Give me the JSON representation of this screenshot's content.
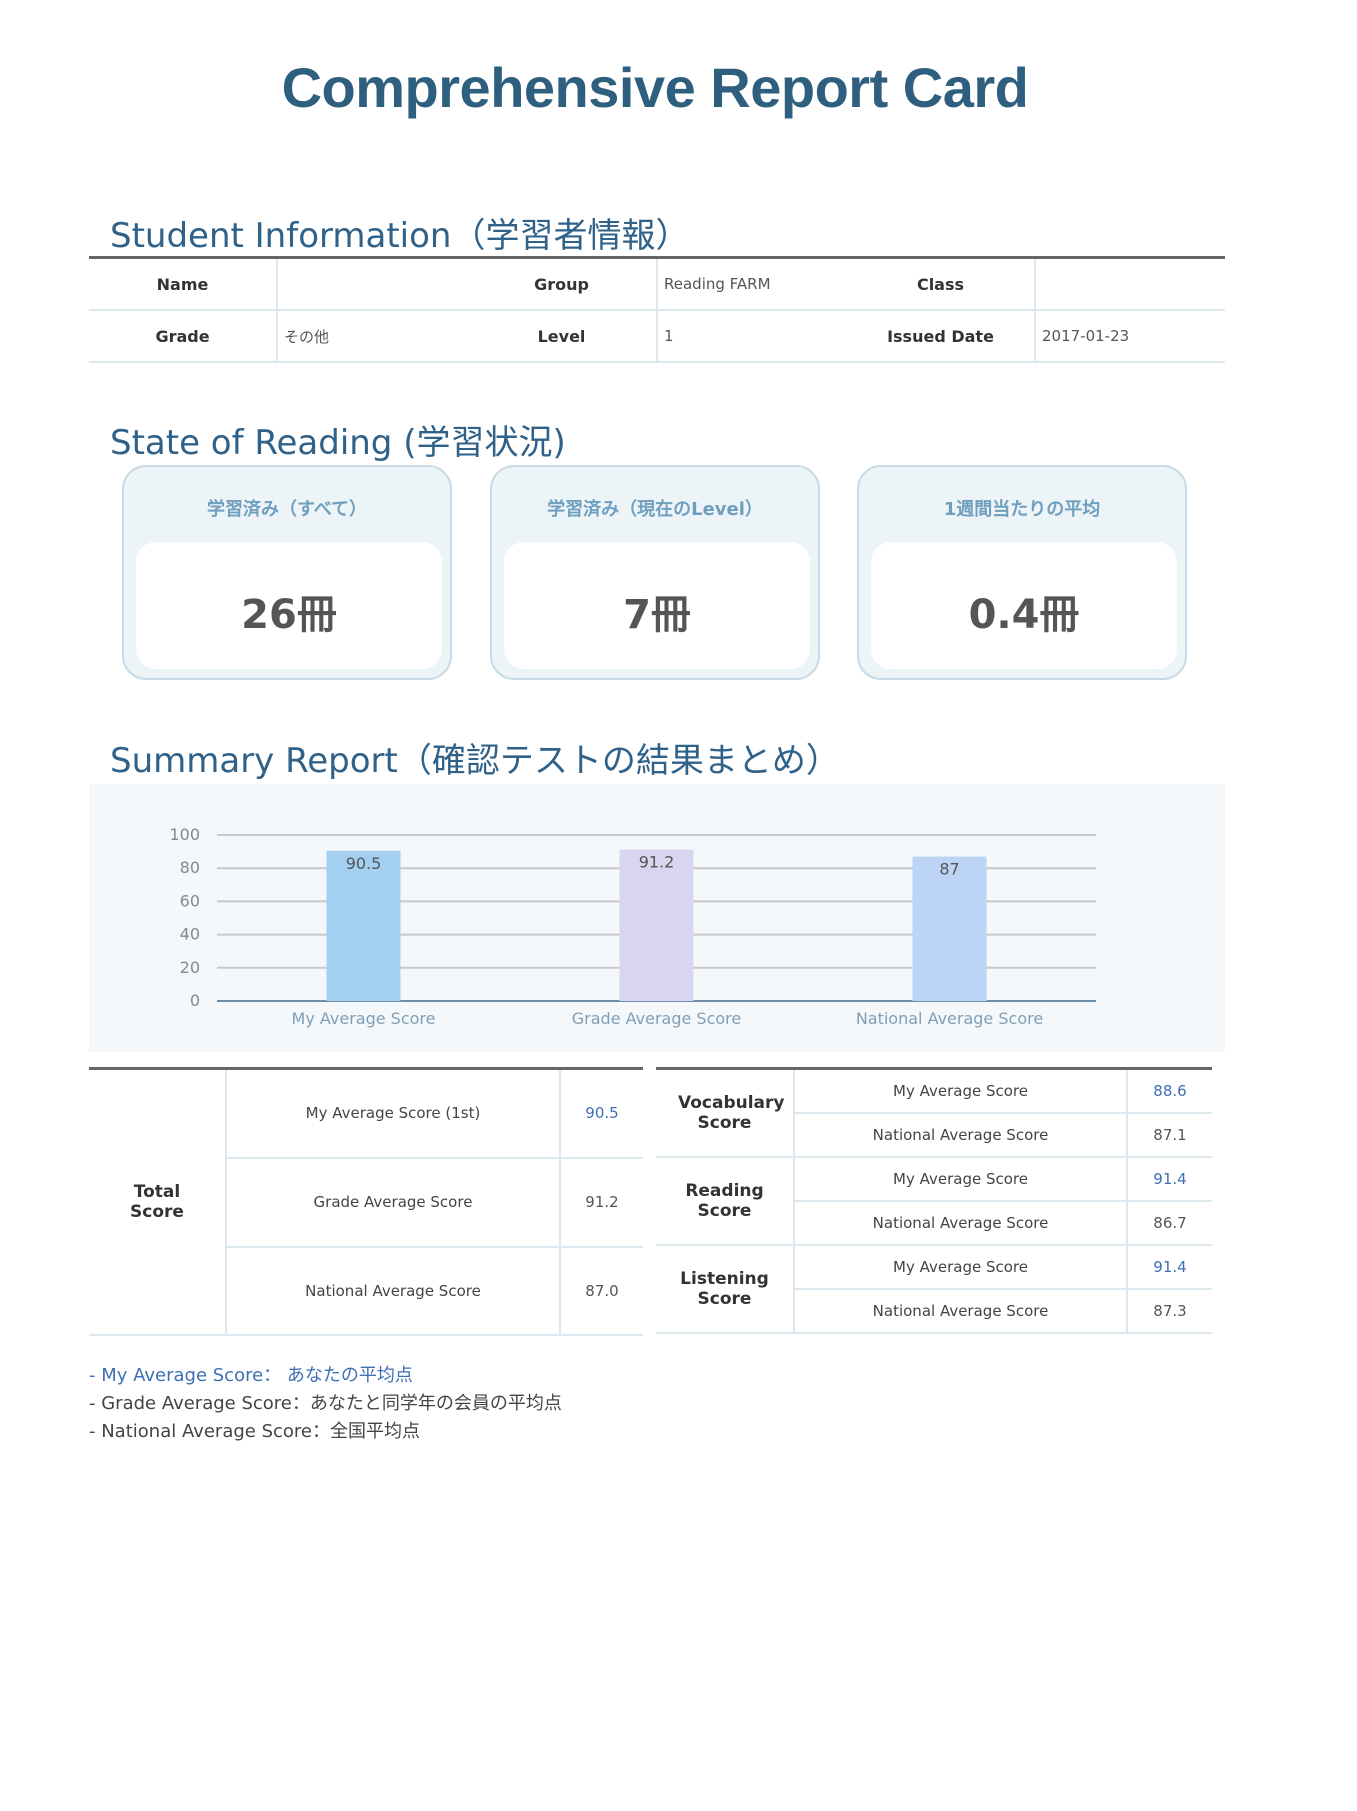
{
  "page": {
    "title": "Comprehensive Report Card"
  },
  "student_info": {
    "section_title": "Student Information（学習者情報）",
    "rows": [
      {
        "label1": "Name",
        "value1": "",
        "label2": "Group",
        "value2": "Reading FARM",
        "label3": "Class",
        "value3": ""
      },
      {
        "label1": "Grade",
        "value1": "その他",
        "label2": "Level",
        "value2": "1",
        "label3": "Issued Date",
        "value3": "2017-01-23"
      }
    ]
  },
  "reading_state": {
    "section_title": "State of Reading (学習状況)",
    "cards": [
      {
        "title": "学習済み（すべて）",
        "value": "26冊"
      },
      {
        "title": "学習済み（現在のLevel）",
        "value": "7冊"
      },
      {
        "title": "1週間当たりの平均",
        "value": "0.4冊"
      }
    ]
  },
  "summary": {
    "section_title": "Summary Report（確認テストの結果まとめ）"
  },
  "chart_data": {
    "type": "bar",
    "categories": [
      "My Average Score",
      "Grade Average Score",
      "National Average Score"
    ],
    "values": [
      90.5,
      91.2,
      87
    ],
    "data_labels": [
      "90.5",
      "91.2",
      "87"
    ],
    "ylim": [
      0,
      100
    ],
    "yticks": [
      0,
      20,
      40,
      60,
      80,
      100
    ],
    "grid": true,
    "colors": [
      "#a3cff0",
      "#d9d4ef",
      "#bcd5f7"
    ],
    "title": "",
    "xlabel": "",
    "ylabel": ""
  },
  "total_score": {
    "label": "Total Score",
    "rows": [
      {
        "name": "My Average Score (1st)",
        "value": "90.5"
      },
      {
        "name": "Grade Average Score",
        "value": "91.2"
      },
      {
        "name": "National Average Score",
        "value": "87.0"
      }
    ]
  },
  "category_scores": [
    {
      "label": "Vocabulary Score",
      "my_name": "My Average Score",
      "my_value": "88.6",
      "nat_name": "National Average Score",
      "nat_value": "87.1"
    },
    {
      "label": "Reading Score",
      "my_name": "My Average Score",
      "my_value": "91.4",
      "nat_name": "National Average Score",
      "nat_value": "86.7"
    },
    {
      "label": "Listening Score",
      "my_name": "My Average Score",
      "my_value": "91.4",
      "nat_name": "National Average Score",
      "nat_value": "87.3"
    }
  ],
  "notes": [
    "- My Average Score： あなたの平均点",
    "- Grade Average Score：あなたと同学年の会員の平均点",
    "- National Average Score：全国平均点"
  ],
  "colors": {
    "title": "#2f5f7f",
    "section": "#2f6189",
    "accent_blue": "#3f6fb3",
    "card_bg": "#edf4f7"
  }
}
